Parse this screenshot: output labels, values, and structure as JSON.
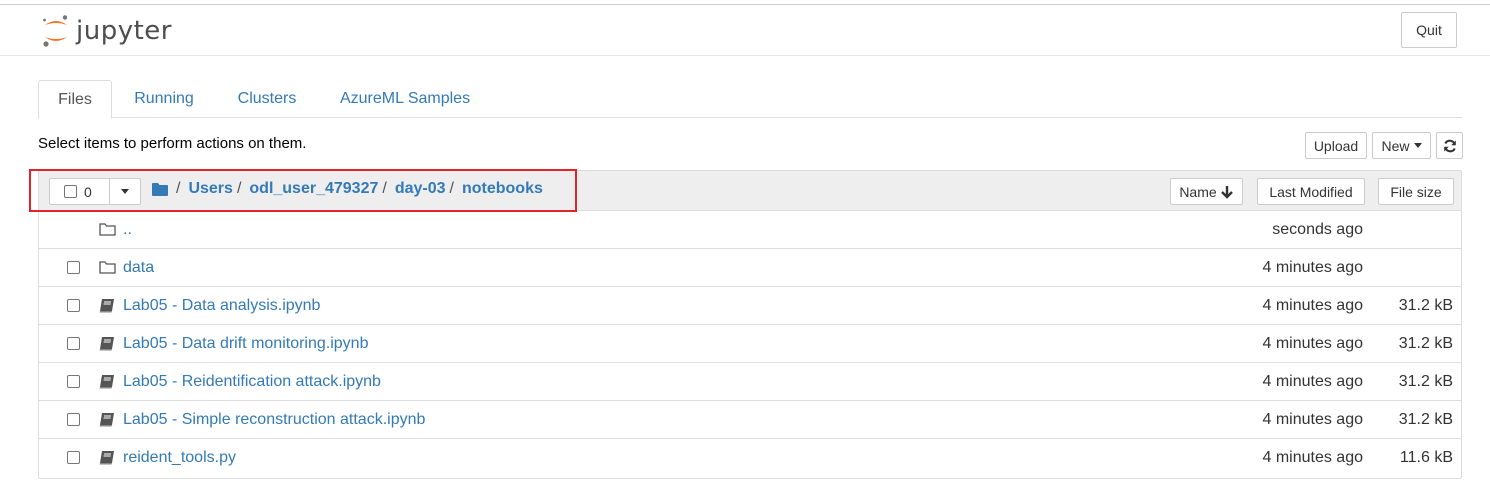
{
  "header": {
    "logo_text": "jupyter",
    "quit_label": "Quit",
    "logo_colors": {
      "orange": "#f37726",
      "gray": "#767677"
    }
  },
  "tabs": [
    {
      "label": "Files",
      "active": true
    },
    {
      "label": "Running",
      "active": false
    },
    {
      "label": "Clusters",
      "active": false
    },
    {
      "label": "AzureML Samples",
      "active": false
    }
  ],
  "toolbar": {
    "hint": "Select items to perform actions on them.",
    "upload_label": "Upload",
    "new_label": "New",
    "refresh_icon": "refresh-icon"
  },
  "selector": {
    "count": "0"
  },
  "breadcrumb": {
    "root_icon": "folder-icon",
    "items": [
      "Users",
      "odl_user_479327",
      "day-03",
      "notebooks"
    ],
    "separator": "/"
  },
  "columns": {
    "name": "Name",
    "last_modified": "Last Modified",
    "file_size": "File size",
    "sort_icon": "arrow-down-icon"
  },
  "rows": [
    {
      "name": "..",
      "type": "folder",
      "modified": "seconds ago",
      "size": ""
    },
    {
      "name": "data",
      "type": "folder",
      "modified": "4 minutes ago",
      "size": ""
    },
    {
      "name": "Lab05 - Data analysis.ipynb",
      "type": "notebook",
      "modified": "4 minutes ago",
      "size": "31.2 kB"
    },
    {
      "name": "Lab05 - Data drift monitoring.ipynb",
      "type": "notebook",
      "modified": "4 minutes ago",
      "size": "31.2 kB"
    },
    {
      "name": "Lab05 - Reidentification attack.ipynb",
      "type": "notebook",
      "modified": "4 minutes ago",
      "size": "31.2 kB"
    },
    {
      "name": "Lab05 - Simple reconstruction attack.ipynb",
      "type": "notebook",
      "modified": "4 minutes ago",
      "size": "31.2 kB"
    },
    {
      "name": "reident_tools.py",
      "type": "file",
      "modified": "4 minutes ago",
      "size": "11.6 kB"
    }
  ],
  "colors": {
    "link": "#337ab7",
    "highlight": "#e0242b"
  }
}
